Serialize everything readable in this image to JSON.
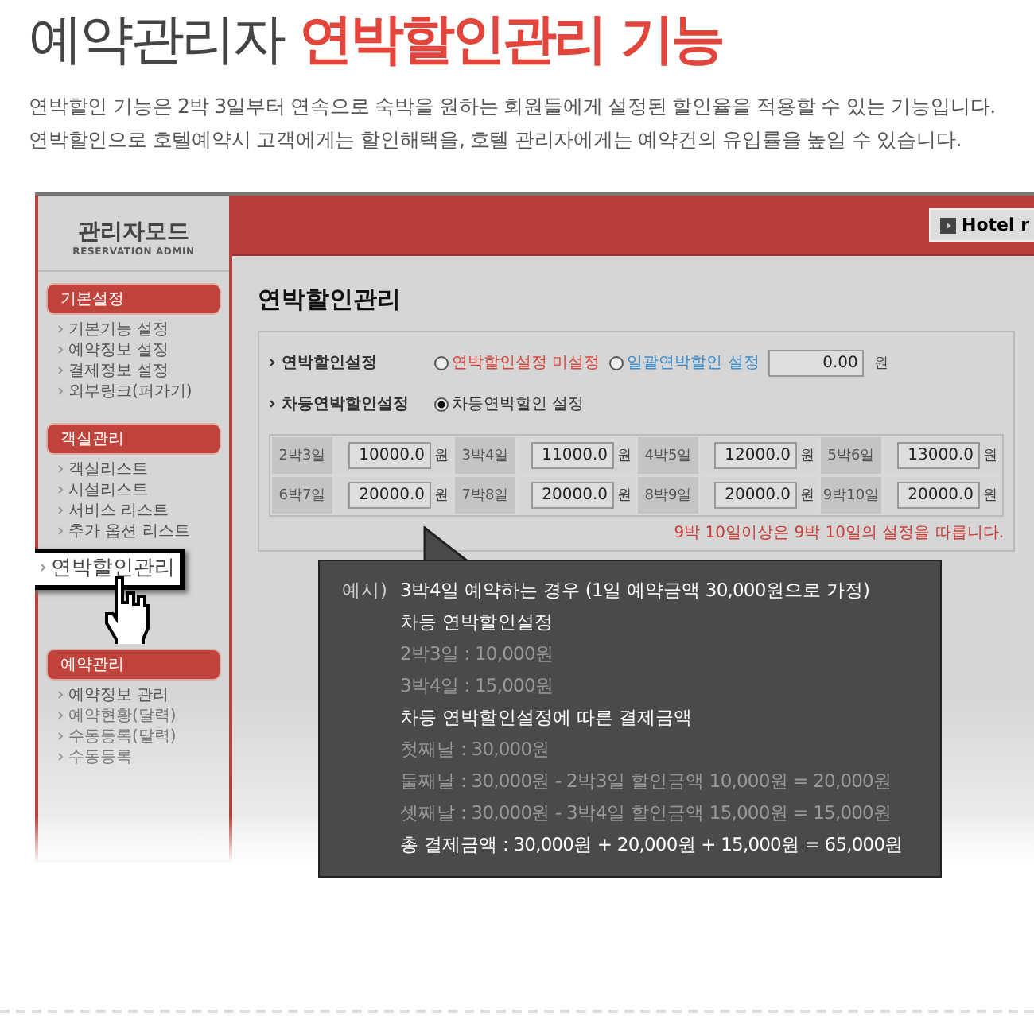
{
  "heading": {
    "text": "예약관리자",
    "highlight": "연박할인관리 기능"
  },
  "description": [
    "연박할인 기능은 2박 3일부터 연속으로 숙박을 원하는 회원들에게 설정된 할인율을 적용할 수 있는 기능입니다.",
    "연박할인으로 호텔예약시 고객에게는 할인해택을, 호텔 관리자에게는 예약건의 유입률을 높일 수 있습니다."
  ],
  "admin": {
    "logo": {
      "title": "관리자모드",
      "subtitle": "RESERVATION ADMIN"
    },
    "sidebar": [
      {
        "title": "기본설정",
        "items": [
          {
            "label": "기본기능 설정",
            "selected": false
          },
          {
            "label": "예약정보 설정",
            "selected": false
          },
          {
            "label": "결제정보 설정",
            "selected": false
          },
          {
            "label": "외부링크(퍼가기)",
            "selected": false
          }
        ]
      },
      {
        "title": "객실관리",
        "items": [
          {
            "label": "객실리스트",
            "selected": false
          },
          {
            "label": "시설리스트",
            "selected": false
          },
          {
            "label": "서비스 리스트",
            "selected": false
          },
          {
            "label": "추가 옵션 리스트",
            "selected": false
          },
          {
            "label": "연박할인관리",
            "selected": true
          }
        ]
      },
      {
        "title": "예약관리",
        "items": [
          {
            "label": "예약정보 관리",
            "selected": false
          },
          {
            "label": "예약현황(달력)",
            "selected": false
          },
          {
            "label": "수동등록(달력)",
            "selected": false
          },
          {
            "label": "수동등록",
            "selected": false
          }
        ]
      }
    ],
    "top_button": "Hotel r",
    "page_title": "연박할인관리",
    "settings": [
      {
        "label": "연박할인설정",
        "options": [
          {
            "label": "연박할인설정 미설정",
            "selected": false,
            "color": "#d9443a"
          },
          {
            "label": "일괄연박할인 설정",
            "selected": false,
            "color": "#3b8fd0"
          }
        ],
        "value": "0.00",
        "unit": "원"
      },
      {
        "label": "차등연박할인설정",
        "options": [
          {
            "label": "차등연박할인 설정",
            "selected": true,
            "color": "#333333"
          }
        ]
      }
    ],
    "rates": [
      {
        "nights": "2박3일",
        "value": "10000.0",
        "unit": "원"
      },
      {
        "nights": "3박4일",
        "value": "11000.0",
        "unit": "원"
      },
      {
        "nights": "4박5일",
        "value": "12000.0",
        "unit": "원"
      },
      {
        "nights": "5박6일",
        "value": "13000.0",
        "unit": "원"
      },
      {
        "nights": "6박7일",
        "value": "20000.0",
        "unit": "원"
      },
      {
        "nights": "7박8일",
        "value": "20000.0",
        "unit": "원"
      },
      {
        "nights": "8박9일",
        "value": "20000.0",
        "unit": "원"
      },
      {
        "nights": "9박10일",
        "value": "20000.0",
        "unit": "원"
      }
    ],
    "note": "9박 10일이상은 9박 10일의 설정을 따릅니다."
  },
  "callout": {
    "label": "예시)",
    "lines": [
      {
        "text": "3박4일 예약하는 경우 (1일 예약금액 30,000원으로 가정)",
        "kind": "strong"
      },
      {
        "text": "차등 연박할인설정",
        "kind": "strong"
      },
      {
        "text": "2박3일 : 10,000원",
        "kind": "muted"
      },
      {
        "text": "3박4일 : 15,000원",
        "kind": "muted"
      },
      {
        "text": "차등 연박할인설정에 따른 결제금액",
        "kind": "strong"
      },
      {
        "text": "첫째날 : 30,000원",
        "kind": "muted"
      },
      {
        "text": "둘째날 : 30,000원 - 2박3일 할인금액 10,000원 = 20,000원",
        "kind": "muted"
      },
      {
        "text": "셋째날 : 30,000원 - 3박4일 할인금액 15,000원 = 15,000원",
        "kind": "muted"
      },
      {
        "text": "총 결제금액 : 30,000원 + 20,000원 + 15,000원 = 65,000원",
        "kind": "strong"
      }
    ]
  }
}
